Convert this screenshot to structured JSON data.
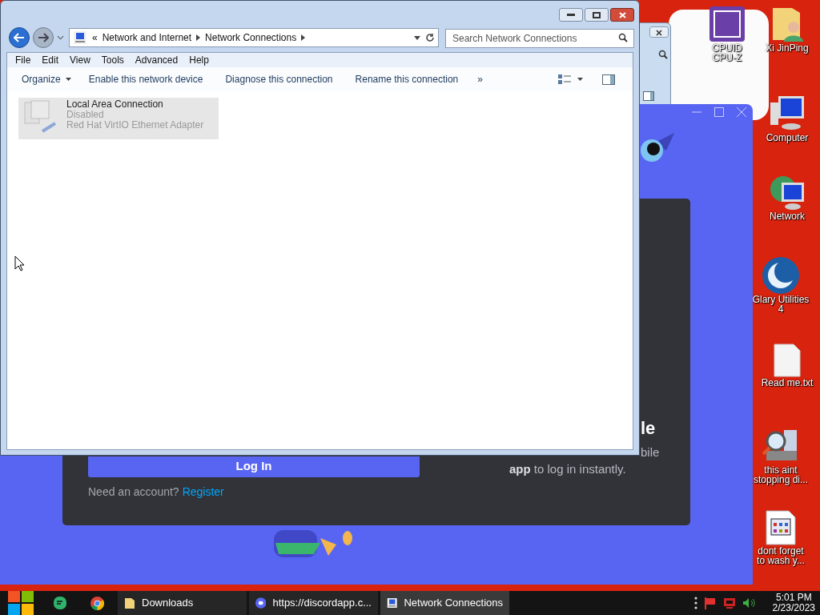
{
  "explorer": {
    "breadcrumb_prefix": "«",
    "path": [
      "Network and Internet",
      "Network Connections"
    ],
    "search_placeholder": "Search Network Connections",
    "menu": [
      "File",
      "Edit",
      "View",
      "Tools",
      "Advanced",
      "Help"
    ],
    "toolbar": [
      {
        "label": "Organize",
        "kind": "dropdown"
      },
      {
        "label": "Enable this network device",
        "kind": "command"
      },
      {
        "label": "Diagnose this connection",
        "kind": "command"
      },
      {
        "label": "Rename this connection",
        "kind": "command"
      },
      {
        "label": "»",
        "kind": "more"
      }
    ],
    "items": [
      {
        "name": "Local Area Connection",
        "status": "Disabled",
        "adapter": "Red Hat VirtIO Ethernet Adapter",
        "selected": true,
        "disabled": true
      }
    ]
  },
  "discord": {
    "login_button": "Log In",
    "need_account": "Need an account?",
    "register": "Register",
    "heading_fragment": "le",
    "text_fragment": "bile",
    "text_line": "**app** to log in instantly."
  },
  "desktop_icons": [
    {
      "lines": [
        "CPUID",
        "CPU-Z"
      ],
      "kind": "cpu-chip"
    },
    {
      "lines": [
        "Xi JinPing"
      ],
      "kind": "user-folder"
    },
    {
      "lines": [
        "Computer"
      ],
      "kind": "computer"
    },
    {
      "lines": [
        "Network"
      ],
      "kind": "network"
    },
    {
      "lines": [
        "Glary Utilities",
        "4"
      ],
      "kind": "glary"
    },
    {
      "lines": [
        "Read me.txt"
      ],
      "kind": "text-file"
    },
    {
      "lines": [
        "this aint",
        "stopping di..."
      ],
      "kind": "disk-search"
    },
    {
      "lines": [
        "dont forget",
        "to wash y..."
      ],
      "kind": "app-file"
    }
  ],
  "taskbar": {
    "windows": [
      {
        "label": "Downloads",
        "kind": "folder",
        "selected": false
      },
      {
        "label": "https://discordapp.c...",
        "kind": "discord",
        "selected": false
      },
      {
        "label": "Network Connections",
        "kind": "network",
        "selected": true
      }
    ],
    "time": "5:01 PM",
    "date": "2/23/2023"
  }
}
